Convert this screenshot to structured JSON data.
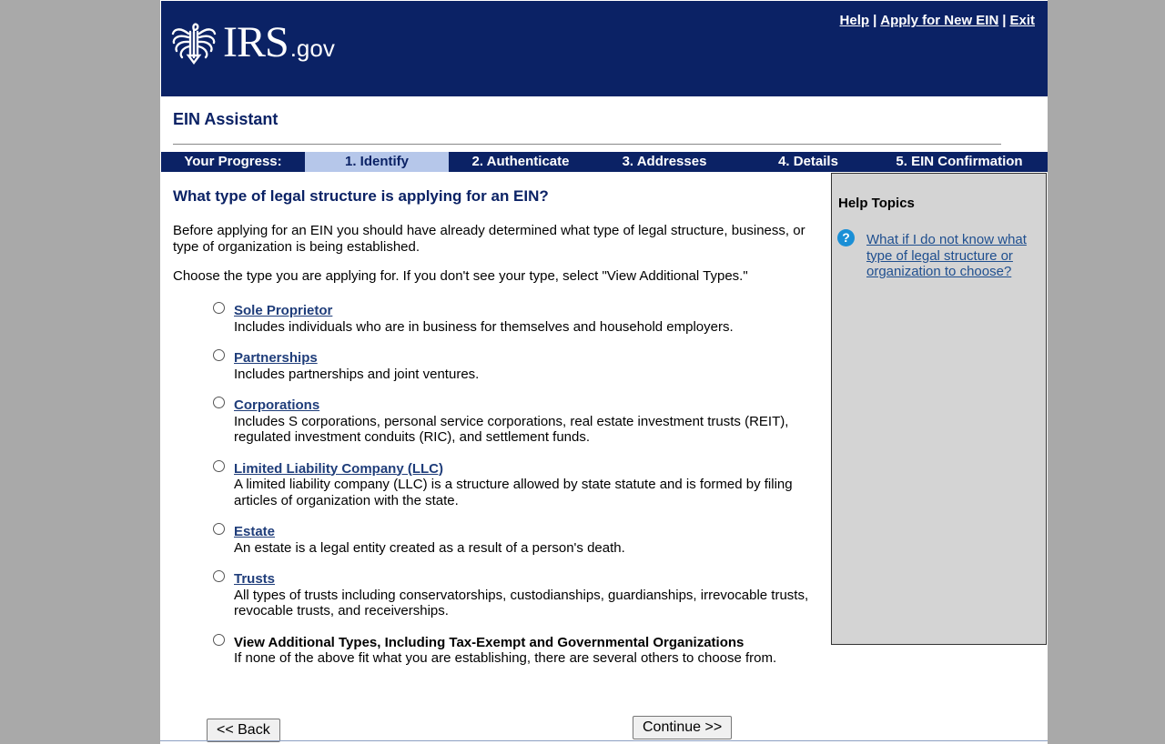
{
  "brand": {
    "logo_main": "IRS",
    "logo_suffix": ".gov"
  },
  "top_links": [
    {
      "label": "Help"
    },
    {
      "label": "Apply for New EIN"
    },
    {
      "label": "Exit"
    }
  ],
  "app_title": "EIN Assistant",
  "progress": {
    "label": "Your Progress:",
    "steps": [
      {
        "label": "1. Identify",
        "active": true
      },
      {
        "label": "2. Authenticate"
      },
      {
        "label": "3. Addresses"
      },
      {
        "label": "4. Details"
      },
      {
        "label": "5. EIN Confirmation"
      }
    ]
  },
  "main": {
    "question": "What type of legal structure is applying for an EIN?",
    "intro": "Before applying for an EIN you should have already determined what type of legal structure, business, or type of organization is being established.",
    "choose": "Choose the type you are applying for. If you don't see your type, select \"View Additional Types.\"",
    "options": [
      {
        "label": "Sole Proprietor",
        "desc": "Includes individuals who are in business for themselves and household employers."
      },
      {
        "label": "Partnerships",
        "desc": "Includes partnerships and joint ventures."
      },
      {
        "label": "Corporations",
        "desc": "Includes S corporations, personal service corporations, real estate investment trusts (REIT), regulated investment conduits (RIC), and settlement funds."
      },
      {
        "label": "Limited Liability Company (LLC)",
        "desc": "A limited liability company (LLC) is a structure allowed by state statute and is formed by filing articles of organization with the state."
      },
      {
        "label": "Estate",
        "desc": "An estate is a legal entity created as a result of a person's death."
      },
      {
        "label": "Trusts",
        "desc": "All types of trusts including conservatorships, custodianships, guardianships, irrevocable trusts, revocable trusts, and receiverships."
      },
      {
        "label": "View Additional Types, Including Tax-Exempt and Governmental Organizations",
        "desc": "If none of the above fit what you are establishing, there are several others to choose from."
      }
    ]
  },
  "help": {
    "title": "Help Topics",
    "icon": "question-icon",
    "link": "What if I do not know what type of legal structure or organization to choose?"
  },
  "buttons": {
    "back": "<< Back",
    "continue": "Continue >>"
  },
  "colors": {
    "navy": "#0b2265",
    "active_step": "#b6c7ea",
    "help_panel": "#d4d4d4",
    "link": "#1f3d7a"
  }
}
